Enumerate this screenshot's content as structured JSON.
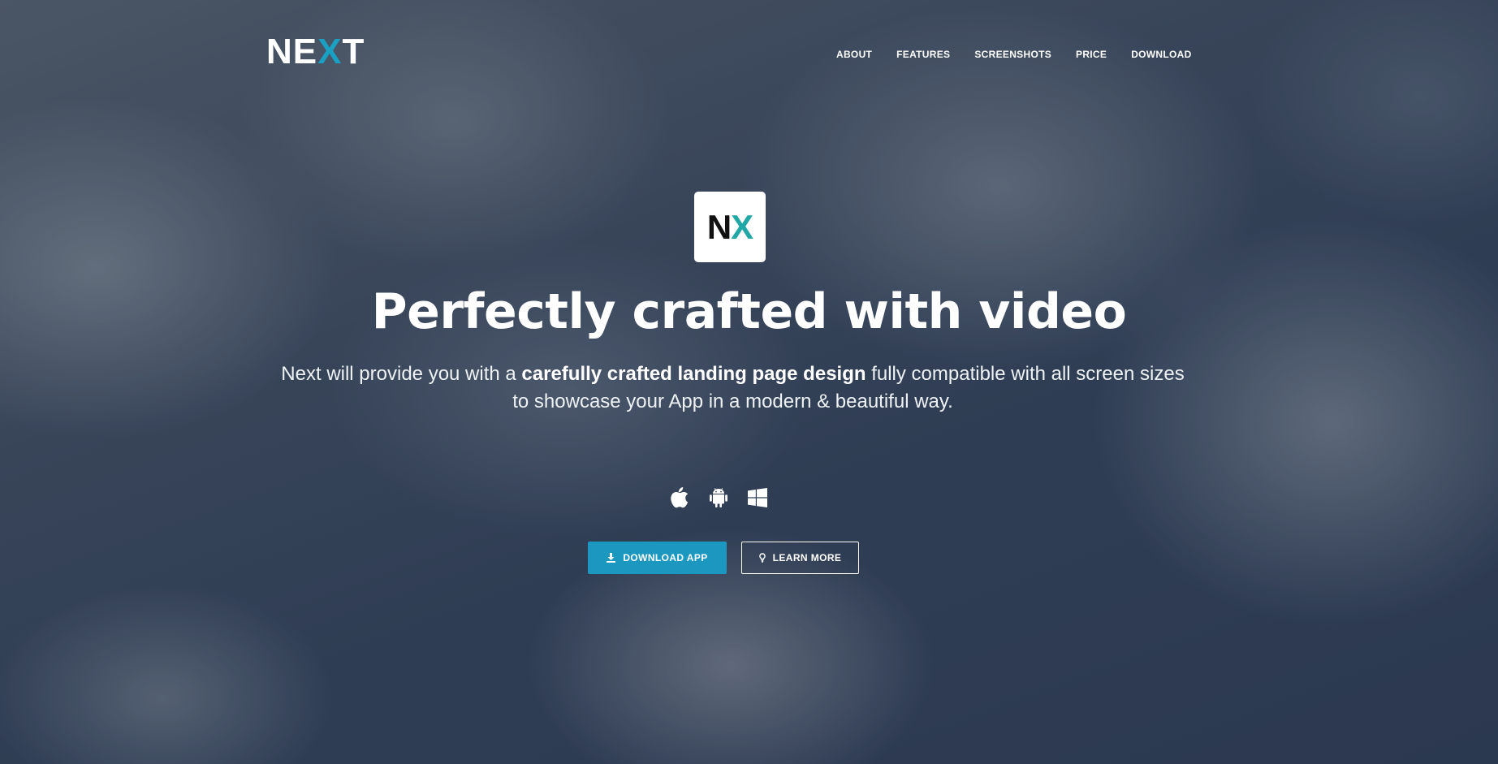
{
  "brand": {
    "logo_prefix": "NE",
    "logo_x": "X",
    "logo_suffix": "T",
    "accent_color": "#1aa0c2",
    "app_icon_n": "N",
    "app_icon_x": "X",
    "app_icon_accent": "#22a7a7"
  },
  "nav": {
    "items": [
      {
        "label": "ABOUT"
      },
      {
        "label": "FEATURES"
      },
      {
        "label": "SCREENSHOTS"
      },
      {
        "label": "PRICE"
      },
      {
        "label": "DOWNLOAD"
      }
    ]
  },
  "hero": {
    "headline": "Perfectly crafted with video",
    "sub_before": "Next will provide you with a ",
    "sub_bold": "carefully crafted landing page design",
    "sub_after": " fully compatible with all screen sizes to showcase your App in a modern & beautiful way."
  },
  "platforms": [
    {
      "icon": "apple-icon"
    },
    {
      "icon": "android-icon"
    },
    {
      "icon": "windows-icon"
    }
  ],
  "buttons": {
    "download_label": "DOWNLOAD APP",
    "download_icon": "download-icon",
    "learn_label": "LEARN MORE",
    "learn_icon": "lightbulb-icon",
    "download_color": "#1c97c0"
  }
}
